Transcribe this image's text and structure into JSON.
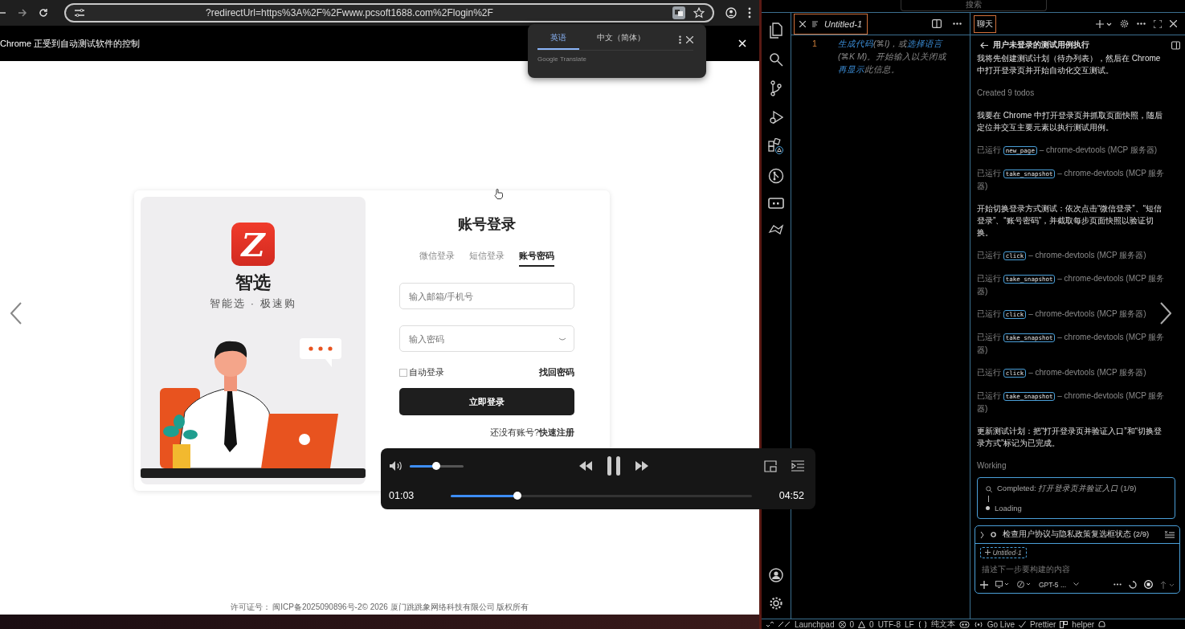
{
  "browser": {
    "address": "?redirectUrl=https%3A%2F%2Fwww.pcsoft1688.com%2Flogin%2F",
    "automation_notice": "Chrome 正受到自动测试软件的控制",
    "translate_popup": {
      "languages": [
        {
          "label": "英语",
          "selected": true
        },
        {
          "label": "中文（简体）",
          "selected": false
        }
      ],
      "provider": "Google Translate"
    }
  },
  "login_page": {
    "logo_letter": "Z",
    "brand": "智选",
    "slogan": "智能选 · 极速购",
    "title": "账号登录",
    "tabs": [
      {
        "label": "微信登录",
        "selected": false
      },
      {
        "label": "短信登录",
        "selected": false
      },
      {
        "label": "账号密码",
        "selected": true
      }
    ],
    "email_placeholder": "输入邮箱/手机号",
    "password_placeholder": "输入密码",
    "remember": {
      "label": "自动登录",
      "checked": false
    },
    "forgot": "找回密码",
    "submit": "立即登录",
    "register_prompt": "还没有账号?",
    "register_link": "快速注册",
    "footer": "许可证号：  闽ICP备2025090896号-2© 2026 厦门跳跳象网络科技有限公司 版权所有"
  },
  "video_player": {
    "playing": true,
    "volume": {
      "level": 0.49
    },
    "elapsed": "01:03",
    "progress": {
      "level": 0.22
    },
    "duration": "04:52"
  },
  "editor": {
    "search_placeholder": "搜索",
    "tab": "Untitled-1",
    "line_number": "1",
    "hint_lines": [
      {
        "segments": [
          {
            "kind": "link",
            "text": "生成代码"
          },
          {
            "kind": "text",
            "text": "(⌘I)，或"
          },
          {
            "kind": "link",
            "text": "选择语言"
          }
        ]
      },
      {
        "segments": [
          {
            "kind": "text",
            "text": "(⌘K M)。开始输入以关闭或"
          }
        ]
      },
      {
        "segments": [
          {
            "kind": "link",
            "text": "再显示"
          },
          {
            "kind": "text",
            "text": "此信息。"
          }
        ]
      }
    ]
  },
  "chat": {
    "tab": "聊天",
    "header": "用户未登录的测试用例执行",
    "messages": [
      {
        "kind": "text",
        "text": "我将先创建测试计划（待办列表），然后在 Chrome 中打开登录页并开始自动化交互测试。"
      },
      {
        "kind": "muted",
        "text": "Created 9 todos"
      },
      {
        "kind": "text",
        "text": "我要在 Chrome 中打开登录页并抓取页面快照，随后定位并交互主要元素以执行测试用例。"
      },
      {
        "kind": "tool",
        "prefix": "已运行",
        "tool": "new_page",
        "source": "– chrome-devtools (MCP 服务器)"
      },
      {
        "kind": "tool",
        "prefix": "已运行",
        "tool": "take_snapshot",
        "source": "– chrome-devtools (MCP 服务器)"
      },
      {
        "kind": "text",
        "text": "开始切换登录方式测试：依次点击“微信登录”、“短信登录”、“账号密码”，并截取每步页面快照以验证切换。"
      },
      {
        "kind": "tool",
        "prefix": "已运行",
        "tool": "click",
        "source": "– chrome-devtools (MCP 服务器)"
      },
      {
        "kind": "tool",
        "prefix": "已运行",
        "tool": "take_snapshot",
        "source": "– chrome-devtools (MCP 服务器)"
      },
      {
        "kind": "tool",
        "prefix": "已运行",
        "tool": "click",
        "source": "– chrome-devtools (MCP 服务器)"
      },
      {
        "kind": "tool",
        "prefix": "已运行",
        "tool": "take_snapshot",
        "source": "– chrome-devtools (MCP 服务器)"
      },
      {
        "kind": "tool",
        "prefix": "已运行",
        "tool": "click",
        "source": "– chrome-devtools (MCP 服务器)"
      },
      {
        "kind": "tool",
        "prefix": "已运行",
        "tool": "take_snapshot",
        "source": "– chrome-devtools (MCP 服务器)"
      },
      {
        "kind": "text",
        "text": "更新测试计划：把“打开登录页并验证入口”和“切换登录方式”标记为已完成。"
      },
      {
        "kind": "muted",
        "text": "Working"
      }
    ],
    "progress": {
      "completed_label": "Completed:",
      "completed_task": "打开登录页并验证入口",
      "completed_count": "(1/9)",
      "loading": "Loading"
    },
    "current_todo": "检查用户协议与隐私政策复选框状态 (2/9)",
    "context_chip": "Untitled-1",
    "input_placeholder": "描述下一步要构建的内容",
    "model": "GPT-5 ..."
  },
  "status_bar": {
    "launchpad": "Launchpad",
    "errors": "0",
    "warnings": "0",
    "encoding": "UTF-8",
    "eol": "LF",
    "language": "纯文本",
    "go_live": "Go Live",
    "prettier": "Prettier",
    "account": "helper"
  }
}
